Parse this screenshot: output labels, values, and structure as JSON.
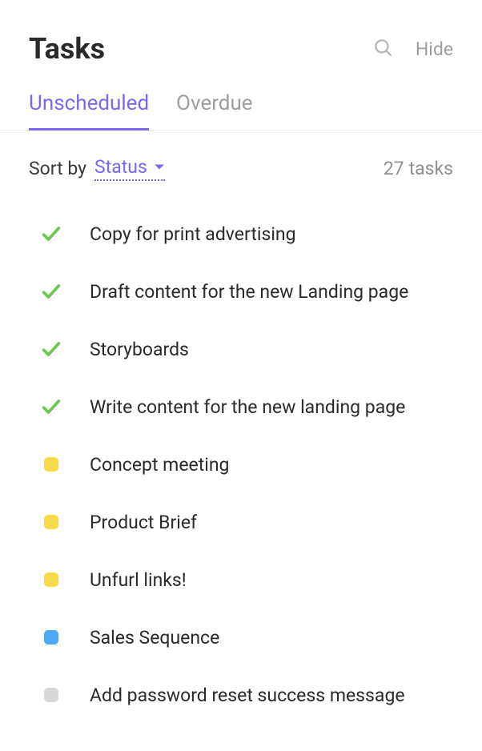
{
  "header": {
    "title": "Tasks",
    "hide_label": "Hide"
  },
  "tabs": [
    {
      "label": "Unscheduled",
      "active": true
    },
    {
      "label": "Overdue",
      "active": false
    }
  ],
  "sort": {
    "label": "Sort by",
    "value": "Status"
  },
  "count": {
    "number": "27",
    "label": "tasks"
  },
  "status_colors": {
    "done": "#6bc950",
    "yellow": "#f7d94c",
    "blue": "#4ea9f7",
    "grey": "#d8d8d8"
  },
  "tasks": [
    {
      "title": "Copy for print advertising",
      "status": "done"
    },
    {
      "title": "Draft content for the new Landing page",
      "status": "done"
    },
    {
      "title": "Storyboards",
      "status": "done"
    },
    {
      "title": "Write content for the new landing page",
      "status": "done"
    },
    {
      "title": "Concept meeting",
      "status": "yellow"
    },
    {
      "title": "Product Brief",
      "status": "yellow"
    },
    {
      "title": "Unfurl links!",
      "status": "yellow"
    },
    {
      "title": "Sales Sequence",
      "status": "blue"
    },
    {
      "title": "Add password reset success message",
      "status": "grey"
    }
  ]
}
